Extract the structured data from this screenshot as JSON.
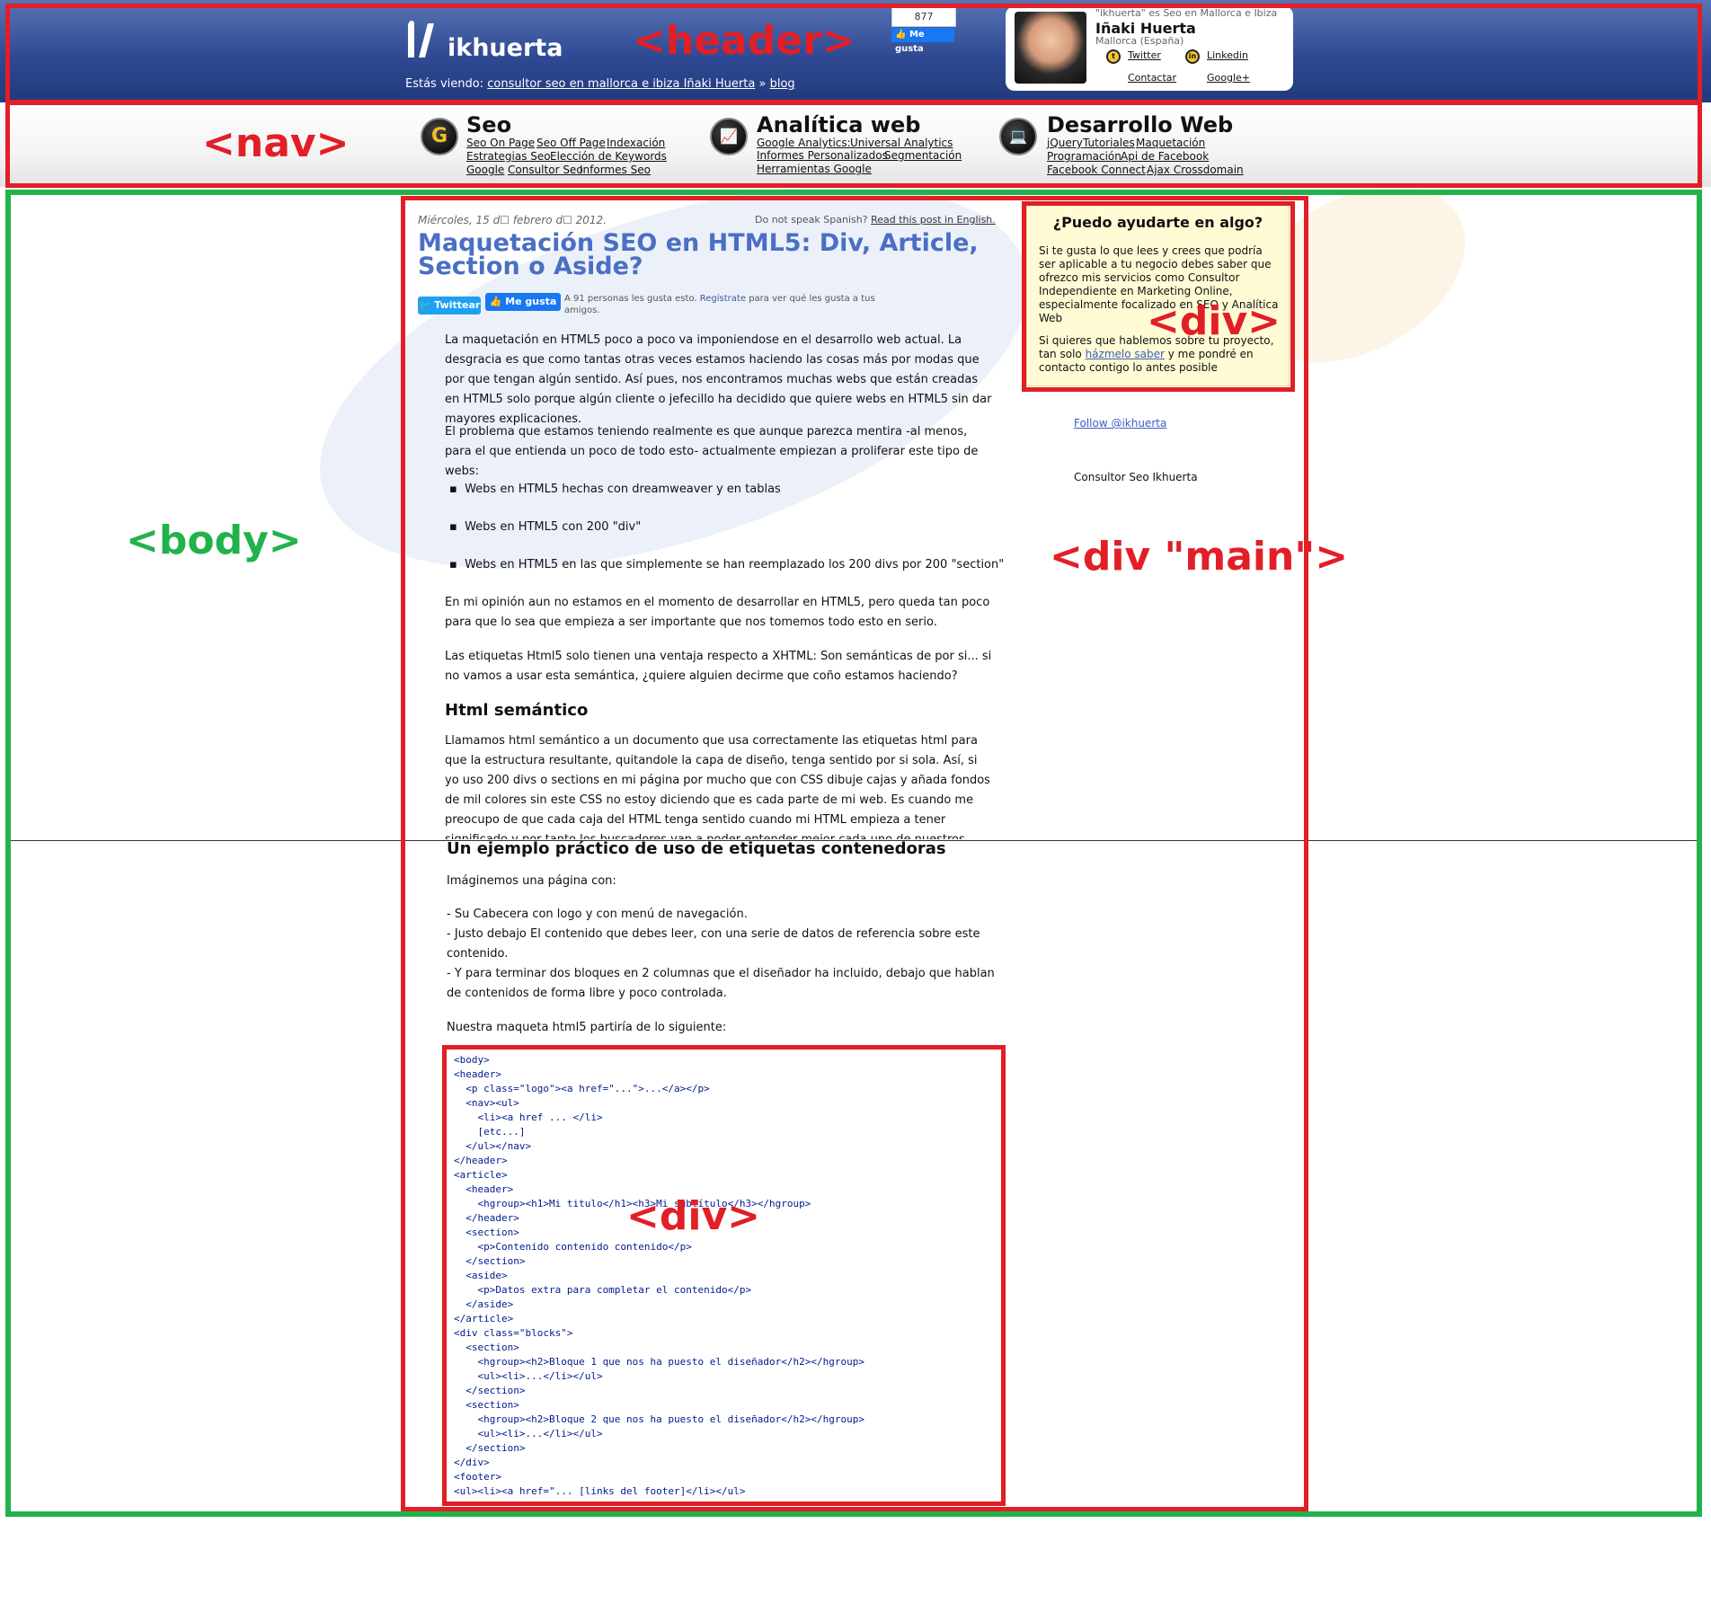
{
  "header": {
    "logo_text": "ikhuerta",
    "breadcrumb_prefix": "Estás viendo:",
    "breadcrumb_link1": "consultor seo en mallorca e ibiza Iñaki Huerta",
    "breadcrumb_sep": "»",
    "breadcrumb_link2": "blog",
    "fb_count": "877",
    "fb_like": "Me gusta"
  },
  "profile": {
    "tagline": "\"ikhuerta\" es Seo en Mallorca e Ibiza",
    "name": "Iñaki Huerta",
    "location": "Mallorca (España)",
    "twitter": "Twitter",
    "linkedin": "Linkedin",
    "contact": "Contactar",
    "googleplus": "Google+"
  },
  "nav": {
    "seo": {
      "title": "Seo",
      "links": [
        "Seo On Page",
        "Seo Off Page",
        "Indexación",
        "Estrategias Seo",
        "Elección de Keywords",
        "Google",
        "Consultor Seo",
        "Informes Seo"
      ]
    },
    "analytics": {
      "title": "Analítica web",
      "links": [
        "Google Analytics:",
        "Universal Analytics",
        "Informes Personalizados",
        "Segmentación",
        "Herramientas Google"
      ]
    },
    "dev": {
      "title": "Desarrollo Web",
      "links": [
        "jQuery",
        "Tutoriales",
        "Maquetación",
        "Programación",
        "Api de Facebook",
        "Facebook Connect",
        "Ajax Crossdomain"
      ]
    }
  },
  "article": {
    "date": "Miércoles, 15 d☐ febrero d☐ 2012.",
    "dont_speak": "Do not speak Spanish?",
    "read_english": "Read this post in English.",
    "title": "Maquetación SEO en HTML5: Div, Article, Section o Aside?",
    "tweet_btn": "Twittear",
    "fb_btn": "Me gusta",
    "fb_text_a": "A 91 personas les gusta esto.",
    "fb_text_link": "Regístrate",
    "fb_text_b": "para ver qué les gusta a tus amigos.",
    "p1": "La maquetación en HTML5 poco a poco va imponiendose en el desarrollo web actual. La desgracia es que como tantas otras veces estamos haciendo las cosas más por modas que por que tengan algún sentido. Así pues, nos encontramos muchas webs que están creadas en HTML5 solo porque algún cliente o jefecillo ha decidido que quiere webs en HTML5 sin dar mayores explicaciones.",
    "p2": "El problema que estamos teniendo realmente es que aunque parezca mentira -al menos, para el que entienda un poco de todo esto- actualmente empiezan a proliferar este tipo de webs:",
    "bullets": [
      "Webs en HTML5 hechas con dreamweaver y en tablas",
      "Webs en HTML5 con 200 \"div\"",
      "Webs en HTML5 en las que simplemente se han reemplazado los 200 divs por 200 \"section\""
    ],
    "p3": "En mi opinión aun no estamos en el momento de desarrollar en HTML5, pero queda tan poco para que lo sea que empieza a ser importante que nos tomemos todo esto en serio.",
    "p4": "Las etiquetas Html5 solo tienen una ventaja respecto a XHTML: Son semánticas de por si... si no vamos a usar esta semántica, ¿quiere alguien decirme que coño estamos haciendo?",
    "h_semantic": "Html semántico",
    "p5": "Llamamos html semántico a un documento que usa correctamente las etiquetas html para que la estructura resultante, quitandole la capa de diseño, tenga sentido por si sola. Así, si yo uso 200 divs o sections en mi página por mucho que con CSS dibuje cajas y añada fondos de mil colores sin este CSS no estoy diciendo que es cada parte de mi web. Es cuando me preocupo de que cada caja del HTML tenga sentido cuando mi HTML empieza a tener significado y por tanto los buscadores van a poder entender mejor cada uno de nuestros contenidos (leer más sobre html semántico).",
    "h_example": "Un ejemplo práctico de uso de etiquetas contenedoras",
    "p6": "Imáginemos una página con:",
    "p7_lines": [
      "- Su Cabecera con logo y con menú de navegación.",
      "- Justo debajo El contenido que debes leer, con una serie de datos de referencia sobre este contenido.",
      "- Y para terminar dos bloques en 2 columnas que el diseñador ha incluido, debajo que hablan de contenidos de forma libre y poco controlada."
    ],
    "p8": "Nuestra maqueta html5 partiría de lo siguiente:",
    "code": "<body>\n<header>\n  <p class=\"logo\"><a href=\"...\">...</a></p>\n  <nav><ul>\n    <li><a href ... </li>\n    [etc...]\n  </ul></nav>\n</header>\n<article>\n  <header>\n    <hgroup><h1>Mi titulo</h1><h3>Mi subtítulo</h3></hgroup>\n  </header>\n  <section>\n    <p>Contenido contenido contenido</p>\n  </section>\n  <aside>\n    <p>Datos extra para completar el contenido</p>\n  </aside>\n</article>\n<div class=\"blocks\">\n  <section>\n    <hgroup><h2>Bloque 1 que nos ha puesto el diseñador</h2></hgroup>\n    <ul><li>...</li></ul>\n  </section>\n  <section>\n    <hgroup><h2>Bloque 2 que nos ha puesto el diseñador</h2></hgroup>\n    <ul><li>...</li></ul>\n  </section>\n</div>\n<footer>\n<ul><li><a href=\"... [links del footer]</li></ul>"
  },
  "sidebar": {
    "help_title": "¿Puedo ayudarte en algo?",
    "help_p1": "Si te gusta lo que lees y crees que podría ser aplicable a tu negocio debes saber que ofrezco mis servicios como Consultor Independiente en Marketing Online, especialmente focalizado en SEO y Analítica Web",
    "help_p2_a": "Si quieres que hablemos sobre tu proyecto, tan solo",
    "help_p2_link": "házmelo saber",
    "help_p2_b": "y me pondré en contacto contigo lo antes posible",
    "follow": "Follow @ikhuerta",
    "consultor": "Consultor Seo Ikhuerta"
  },
  "annotations": {
    "header": "<header>",
    "nav": "<nav>",
    "body": "<body>",
    "div1": "<div>",
    "div_main": "<div \"main\">",
    "div2": "<div>"
  },
  "colors": {
    "annotation_red": "#e21e26",
    "annotation_green": "#22b24c",
    "title_blue": "#4a6fc4",
    "header_blue": "#2f4a93"
  }
}
